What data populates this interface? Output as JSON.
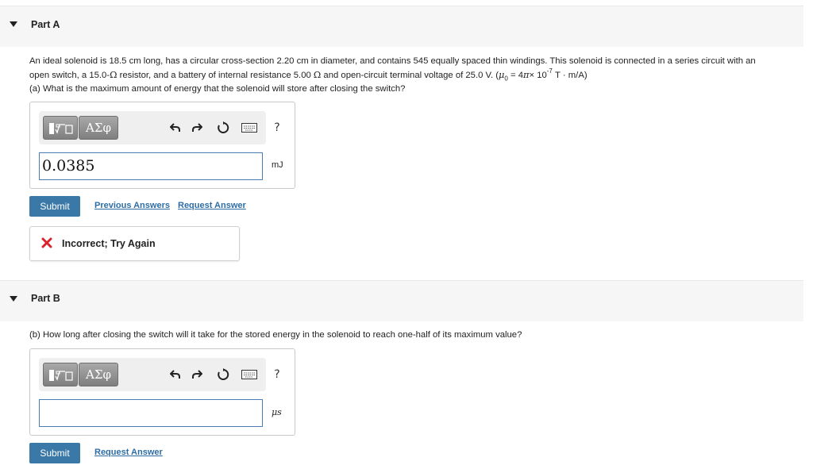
{
  "part_a": {
    "title": "Part A",
    "problem_line1": "An ideal solenoid is 18.5 cm long, has a circular cross-section 2.20 cm in diameter, and contains 545 equally spaced thin windings. This solenoid is connected in a series circuit with an",
    "problem_line2_a": "open switch, a 15.0-",
    "problem_line2_b": " resistor, and a battery of internal resistance 5.00 ",
    "problem_line2_c": " and open-circuit terminal voltage of 25.0 V. (",
    "mu": "μ",
    "mu_sub": "0",
    "eq_text": " = 4",
    "pi": "π",
    "times_ten": "× 10",
    "exp": "-7",
    "units_tail": " T · m/A)",
    "ohm": "Ω",
    "question": "(a) What is the maximum amount of energy that the solenoid will store after closing the switch?",
    "answer_value": "0.0385",
    "unit": "mJ",
    "submit_label": "Submit",
    "previous_answers_label": "Previous Answers",
    "request_answer_label": "Request Answer",
    "feedback": "Incorrect; Try Again"
  },
  "part_b": {
    "title": "Part B",
    "question": "(b) How long after closing the switch will it take for the stored energy in the solenoid to reach one-half of its maximum value?",
    "answer_value": "",
    "unit": "μs",
    "submit_label": "Submit",
    "request_answer_label": "Request Answer"
  },
  "toolbar": {
    "greek_label": "ΑΣφ",
    "help_label": "?",
    "icons": [
      "templates-icon",
      "greek-symbols-icon",
      "undo-icon",
      "redo-icon",
      "reset-icon",
      "keyboard-icon",
      "help-icon"
    ]
  },
  "colors": {
    "submit_bg": "#3a78a8",
    "link": "#2e6da4",
    "error_x": "#d9232d",
    "input_border": "#4a7db3"
  }
}
